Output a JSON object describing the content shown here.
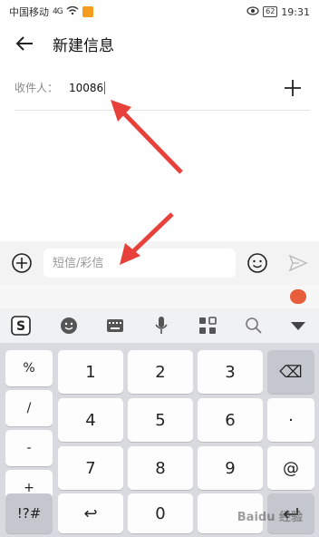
{
  "status_bar": {
    "carrier": "中国移动",
    "signal": "4G",
    "battery": "62",
    "time": "19:31"
  },
  "header": {
    "title": "新建信息",
    "back_icon": "arrow-left-icon"
  },
  "recipient": {
    "label": "收件人：",
    "value": "10086"
  },
  "compose": {
    "placeholder": "短信/彩信"
  },
  "keyboard": {
    "toolbar_icons": [
      "sogou-logo-icon",
      "emoji-icon",
      "keyboard-icon",
      "microphone-icon",
      "grid-icon",
      "search-icon",
      "collapse-icon"
    ],
    "side_keys": [
      "%",
      "/",
      "-",
      "+"
    ],
    "row1": [
      "1",
      "2",
      "3"
    ],
    "row2": [
      "4",
      "5",
      "6"
    ],
    "row3": [
      "7",
      "8",
      "9"
    ],
    "right_keys": [
      "⌫",
      "·",
      "@"
    ],
    "bottom": {
      "symbols": "!?#",
      "back": "↩",
      "zero": "0"
    },
    "watermark": "Baidu 经验"
  },
  "colors": {
    "accent": "#1a73e8",
    "arrow": "#e8413b",
    "keyboard_bg": "#d8dadf"
  }
}
